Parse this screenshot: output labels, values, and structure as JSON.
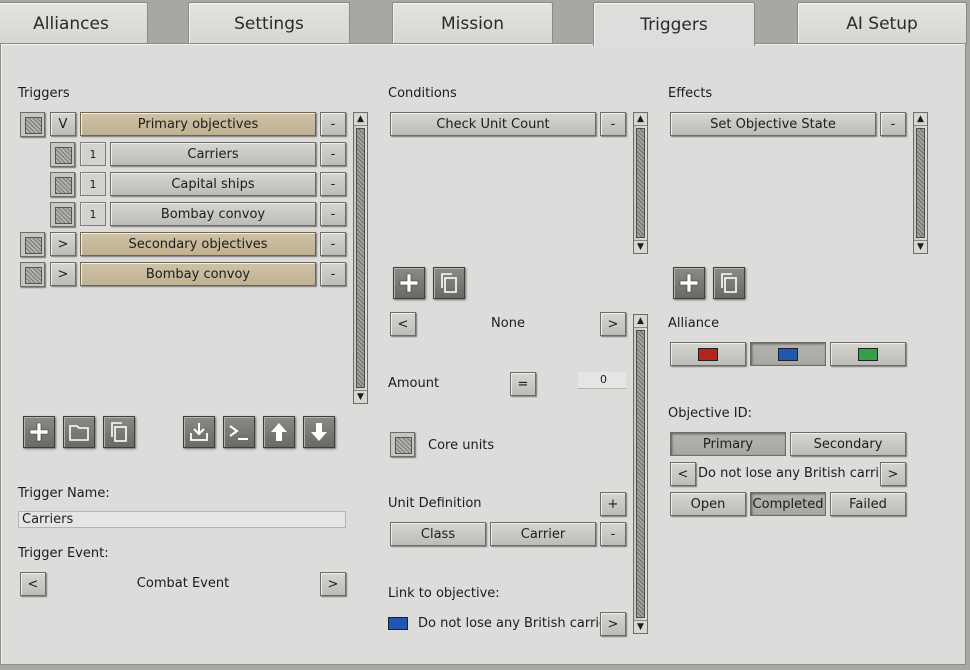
{
  "tabs": [
    "Alliances",
    "Settings",
    "Mission",
    "Triggers",
    "AI Setup"
  ],
  "triggers": {
    "heading": "Triggers",
    "rows": [
      {
        "toggle": "V",
        "label": "Primary objectives",
        "remove": "-"
      },
      {
        "num": "1",
        "label": "Carriers",
        "remove": "-"
      },
      {
        "num": "1",
        "label": "Capital ships",
        "remove": "-"
      },
      {
        "num": "1",
        "label": "Bombay convoy",
        "remove": "-"
      },
      {
        "toggle": ">",
        "label": "Secondary objectives",
        "remove": "-"
      },
      {
        "toggle": ">",
        "label": "Bombay convoy",
        "remove": "-"
      }
    ],
    "toolbar_icons": [
      "add-icon",
      "folder-icon",
      "copy-icon",
      "import-icon",
      "console-icon",
      "arrow-up-icon",
      "arrow-down-icon"
    ],
    "trigger_name_label": "Trigger Name:",
    "trigger_name_value": "Carriers",
    "trigger_event_label": "Trigger Event:",
    "trigger_event_value": "Combat Event",
    "prev": "<",
    "next": ">"
  },
  "conditions": {
    "heading": "Conditions",
    "items": [
      {
        "label": "Check Unit Count",
        "remove": "-"
      }
    ],
    "selector_value": "None",
    "prev": "<",
    "next": ">",
    "amount_label": "Amount",
    "amount_operator": "=",
    "amount_value": "0",
    "core_units_label": "Core units",
    "unit_definition_label": "Unit Definition",
    "unit_definition_add": "+",
    "unit_definition_remove": "-",
    "unit_class": "Class",
    "unit_value": "Carrier",
    "link_label": "Link to objective:",
    "link_value": "Do not lose any British carriers",
    "link_color": "#1f57b3"
  },
  "effects": {
    "heading": "Effects",
    "items": [
      {
        "label": "Set Objective State",
        "remove": "-"
      }
    ],
    "alliance_label": "Alliance",
    "alliance_colors": [
      "#b3261e",
      "#1f57b3",
      "#34a04a"
    ],
    "objective_id_label": "Objective ID:",
    "objective_types": [
      "Primary",
      "Secondary"
    ],
    "objective_value": "Do not lose any British carriers",
    "prev": "<",
    "next": ">",
    "states": [
      "Open",
      "Completed",
      "Failed"
    ]
  }
}
